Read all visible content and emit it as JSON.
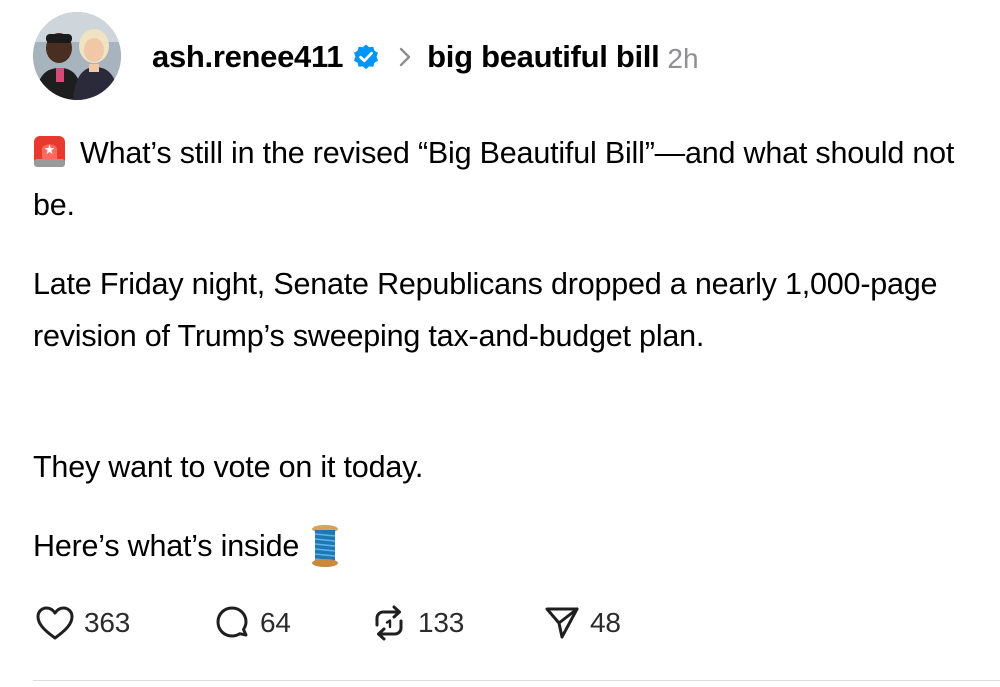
{
  "post": {
    "username": "ash.renee411",
    "topic": "big beautiful bill",
    "time": "2h",
    "lines": {
      "p1": "What’s still in the revised “Big Beautiful Bill”—and what should not be.",
      "p2": "Late Friday night, Senate Republicans dropped a nearly 1,000-page revision of Trump’s sweeping tax-and-budget plan.",
      "p3": "They want to vote on it today.",
      "p4": "Here’s what’s inside"
    },
    "emoji": {
      "lead": "police-car-light",
      "trail": "thread-spool"
    },
    "actions": {
      "likes": "363",
      "replies": "64",
      "reposts": "133",
      "shares": "48"
    }
  },
  "icons": {
    "verified": "verified-badge-icon",
    "chevron": "chevron-right-icon",
    "like": "heart-icon",
    "reply": "comment-bubble-icon",
    "repost": "repost-arrows-icon",
    "share": "paper-plane-icon"
  },
  "colors": {
    "verified_blue": "#0095f6",
    "meta_gray": "#8e8e93",
    "text": "#000000"
  }
}
